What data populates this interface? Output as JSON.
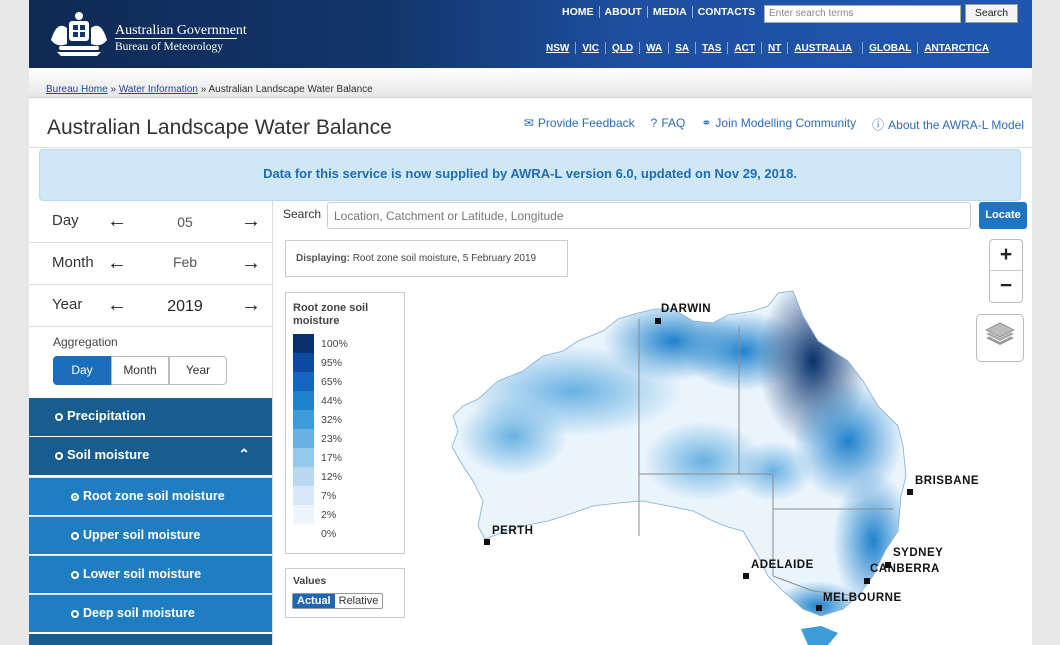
{
  "header": {
    "logo_line1": "Australian Government",
    "logo_line2": "Bureau of Meteorology",
    "nav": [
      "HOME",
      "ABOUT",
      "MEDIA",
      "CONTACTS"
    ],
    "search_placeholder": "Enter search terms",
    "search_button": "Search",
    "states": [
      "NSW",
      "VIC",
      "QLD",
      "WA",
      "SA",
      "TAS",
      "ACT",
      "NT",
      "AUSTRALIA",
      "GLOBAL",
      "ANTARCTICA"
    ]
  },
  "breadcrumb": {
    "home": "Bureau Home",
    "sep": "»",
    "water": "Water Information",
    "current": "Australian Landscape Water Balance"
  },
  "page": {
    "title": "Australian Landscape Water Balance",
    "links": [
      "Provide Feedback",
      "FAQ",
      "Join Modelling Community",
      "About the AWRA-L Model"
    ],
    "notice": "Data for this service is now supplied by AWRA-L version 6.0, updated on Nov 29, 2018."
  },
  "date": {
    "day_label": "Day",
    "day_value": "05",
    "month_label": "Month",
    "month_value": "Feb",
    "year_label": "Year",
    "year_value": "2019"
  },
  "aggregation": {
    "label": "Aggregation",
    "options": [
      "Day",
      "Month",
      "Year"
    ],
    "selected": "Day"
  },
  "menu": {
    "precipitation": "Precipitation",
    "soil_moisture": "Soil moisture",
    "sub": [
      "Root zone soil moisture",
      "Upper soil moisture",
      "Lower soil moisture",
      "Deep soil moisture"
    ]
  },
  "search": {
    "label": "Search",
    "placeholder": "Location, Catchment or Latitude, Longitude",
    "locate": "Locate"
  },
  "map": {
    "displaying_label": "Displaying:",
    "displaying_value": "Root zone soil moisture, 5 February 2019",
    "legend_title": "Root zone soil moisture",
    "legend": [
      {
        "label": "100%",
        "color": "#08306b"
      },
      {
        "label": "95%",
        "color": "#0b4a9c"
      },
      {
        "label": "65%",
        "color": "#1565c0"
      },
      {
        "label": "44%",
        "color": "#1f82cc"
      },
      {
        "label": "32%",
        "color": "#3d9bd8"
      },
      {
        "label": "23%",
        "color": "#68b1e2"
      },
      {
        "label": "17%",
        "color": "#94c8ec"
      },
      {
        "label": "12%",
        "color": "#b9d9f2"
      },
      {
        "label": "7%",
        "color": "#d7e9f8"
      },
      {
        "label": "2%",
        "color": "#eef6fd"
      },
      {
        "label": "0%",
        "color": "#ffffff"
      }
    ],
    "values_label": "Values",
    "values_options": [
      "Actual",
      "Relative"
    ],
    "zoom_in": "+",
    "zoom_out": "−",
    "cities": [
      "DARWIN",
      "BRISBANE",
      "PERTH",
      "SYDNEY",
      "CANBERRA",
      "ADELAIDE",
      "MELBOURNE"
    ]
  }
}
